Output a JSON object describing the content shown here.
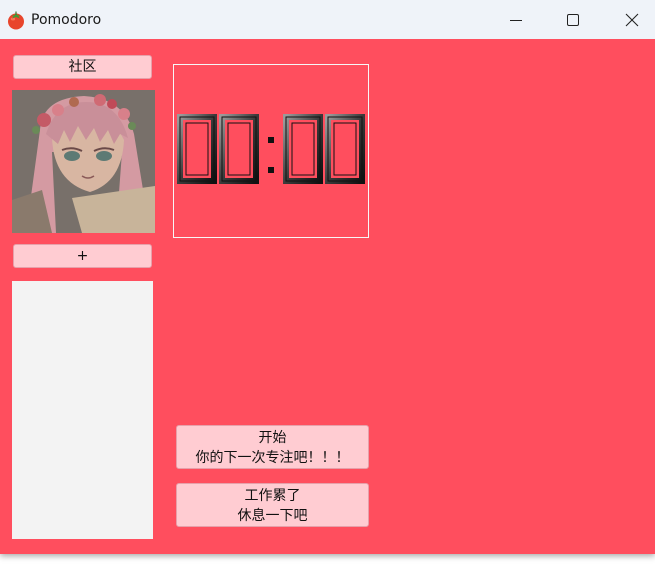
{
  "window": {
    "title": "Pomodoro",
    "app_icon": "tomato-icon",
    "controls": [
      "minimize-icon",
      "maximize-icon",
      "close-icon"
    ]
  },
  "sidebar": {
    "community_label": "社区",
    "add_label": "+",
    "avatar": "anime-avatar-image"
  },
  "timer": {
    "display": "00:00",
    "minutes": "00",
    "seconds": "00"
  },
  "actions": {
    "start": {
      "line1": "开始",
      "line2": "你的下一次专注吧！！！"
    },
    "rest": {
      "line1": "工作累了",
      "line2": "休息一下吧"
    }
  },
  "colors": {
    "background": "#ff4e5e",
    "button": "#ffccd2",
    "titlebar": "#eff3f9",
    "panel": "#f3f3f3"
  }
}
